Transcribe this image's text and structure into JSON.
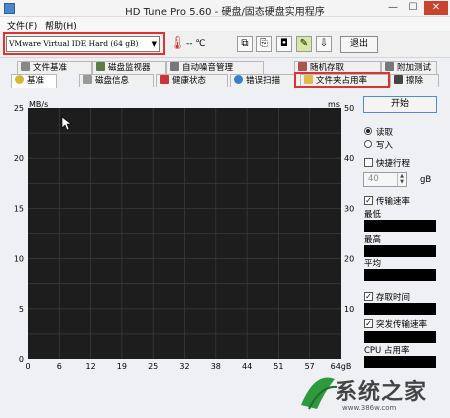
{
  "title": "HD Tune Pro 5.60 - 硬盘/固态硬盘实用程序",
  "menu": {
    "file": "文件(F)",
    "help": "帮助(H)"
  },
  "toolbar": {
    "drive": "VMware Virtual IDE Hard (64 gB)",
    "temperature": "-- ℃",
    "exit_label": "退出"
  },
  "tabs_row1": [
    {
      "label": "文件基准"
    },
    {
      "label": "磁盘监视器"
    },
    {
      "label": "自动噪音管理"
    },
    {
      "label": "随机存取"
    },
    {
      "label": "附加测试"
    }
  ],
  "tabs_row2": [
    {
      "label": "基准"
    },
    {
      "label": "磁盘信息"
    },
    {
      "label": "健康状态"
    },
    {
      "label": "错误扫描"
    },
    {
      "label": "文件夹占用率"
    },
    {
      "label": "擦除"
    }
  ],
  "chart_data": {
    "type": "line",
    "ylabel_left": "MB/s",
    "ylabel_right": "ms",
    "y_left_ticks": [
      "25",
      "20",
      "15",
      "10",
      "5",
      "0"
    ],
    "y_right_ticks": [
      "50",
      "40",
      "30",
      "20",
      "10"
    ],
    "x_ticks": [
      "0",
      "6",
      "12",
      "19",
      "25",
      "32",
      "38",
      "44",
      "51",
      "57",
      "64gB"
    ],
    "ylim_left": [
      0,
      25
    ],
    "ylim_right": [
      0,
      50
    ],
    "xlim": [
      0,
      64
    ],
    "grid": true,
    "series": []
  },
  "panel": {
    "start_label": "开始",
    "read_label": "读取",
    "write_label": "写入",
    "short_stroke_label": "快捷行程",
    "short_stroke_value": "40",
    "short_stroke_unit": "gB",
    "transfer_rate_label": "传输速率",
    "min_label": "最低",
    "max_label": "最高",
    "avg_label": "平均",
    "access_time_label": "存取时间",
    "burst_rate_label": "突发传输速率",
    "cpu_label": "CPU 占用率"
  },
  "watermark": {
    "text": "系统之家",
    "url": "www.386w.com"
  },
  "colors": {
    "highlight": "#dd3333",
    "plot_bg": "#1d1d1d",
    "grid": "#3a3a3a"
  }
}
